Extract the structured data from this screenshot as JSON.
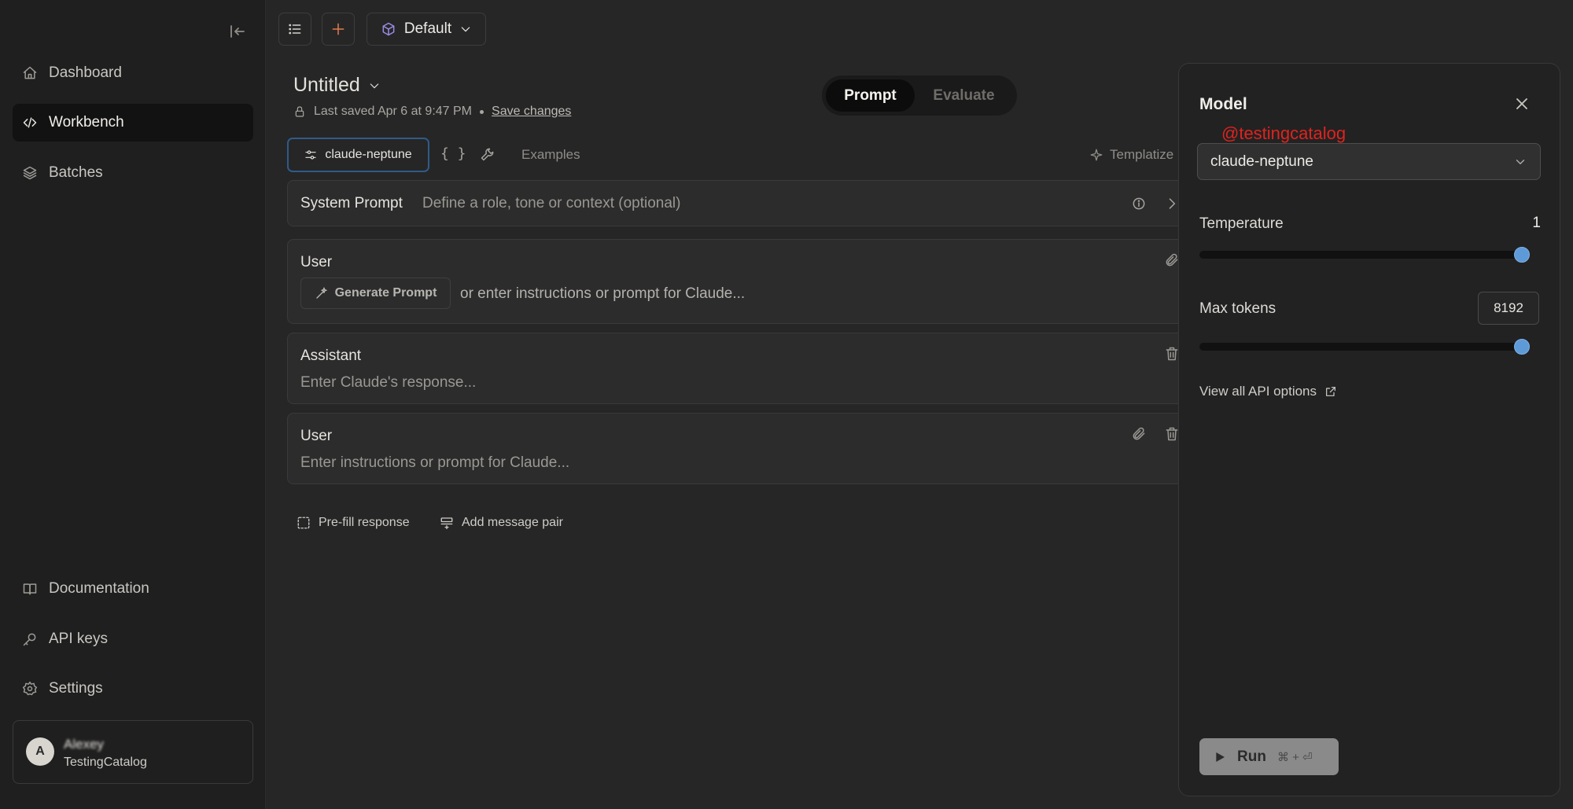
{
  "sidebar": {
    "nav": [
      {
        "label": "Dashboard",
        "icon": "home-icon"
      },
      {
        "label": "Workbench",
        "icon": "code-icon",
        "active": true
      },
      {
        "label": "Batches",
        "icon": "layers-icon"
      }
    ],
    "bottom_nav": [
      {
        "label": "Documentation",
        "icon": "book-icon"
      },
      {
        "label": "API keys",
        "icon": "key-icon"
      },
      {
        "label": "Settings",
        "icon": "gear-icon"
      }
    ],
    "account": {
      "initial": "A",
      "name": "Alexey",
      "org": "TestingCatalog"
    }
  },
  "toolbar": {
    "project": "Default"
  },
  "document": {
    "title": "Untitled",
    "saved_text": "Last saved Apr 6 at 9:47 PM",
    "save_changes": "Save changes"
  },
  "mode": {
    "prompt": "Prompt",
    "evaluate": "Evaluate"
  },
  "model_row": {
    "model": "claude-neptune",
    "vars": "{ }",
    "examples": "Examples",
    "templatize": "Templatize"
  },
  "messages": {
    "system": {
      "label": "System Prompt",
      "placeholder": "Define a role, tone or context (optional)"
    },
    "user1": {
      "role": "User",
      "generate": "Generate Prompt",
      "alt": "or enter instructions or prompt for Claude..."
    },
    "assistant": {
      "role": "Assistant",
      "placeholder": "Enter Claude's response..."
    },
    "user2": {
      "role": "User",
      "placeholder": "Enter instructions or prompt for Claude..."
    }
  },
  "actions": {
    "prefill": "Pre-fill response",
    "add_pair": "Add message pair"
  },
  "settings": {
    "title": "Model",
    "watermark": "@testingcatalog",
    "model": "claude-neptune",
    "temperature_label": "Temperature",
    "temperature_value": "1",
    "temperature_fraction": 1.0,
    "max_tokens_label": "Max tokens",
    "max_tokens_value": "8192",
    "max_tokens_fraction": 1.0,
    "api_link": "View all API options",
    "run": "Run",
    "run_shortcut": "⌘ + ⏎"
  },
  "colors": {
    "accent": "#5f9ad8",
    "chip_border": "#2f5b88",
    "watermark": "#e0231f"
  }
}
